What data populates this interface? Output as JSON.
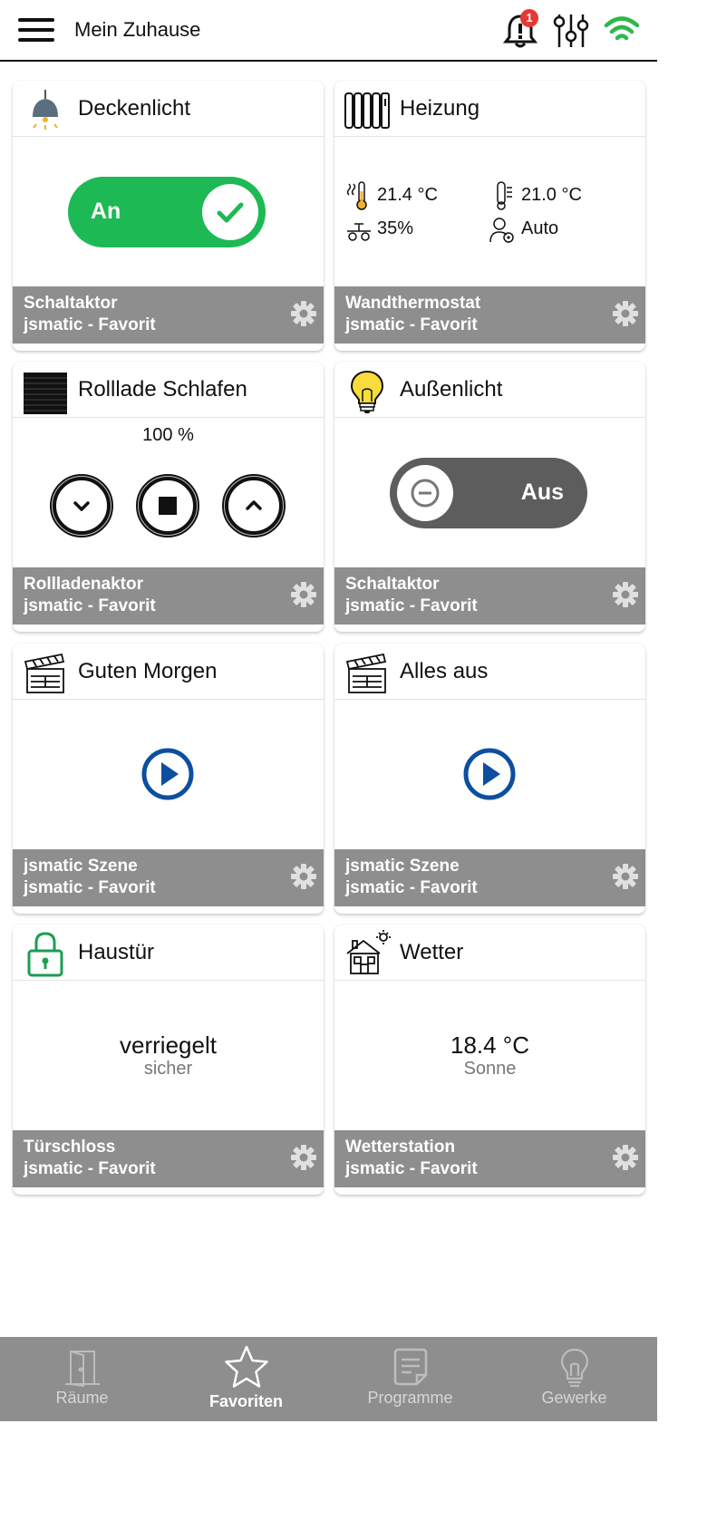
{
  "header": {
    "title": "Mein Zuhause",
    "notification_count": "1",
    "icons": [
      "menu-icon",
      "bell-icon",
      "sliders-icon",
      "wifi-icon"
    ]
  },
  "colors": {
    "on_green": "#1db954",
    "off_gray": "#5d5d5d",
    "footer_gray": "#8e8e8e",
    "play_blue": "#0d4f9e",
    "lock_green": "#1b9e52",
    "badge_red": "#e53935",
    "wifi_green": "#2eb84b"
  },
  "cards": [
    {
      "title": "Deckenlicht",
      "icon": "ceiling-lamp-icon",
      "toggle_label": "An",
      "footer_line1": "Schaltaktor",
      "footer_line2": "jsmatic - Favorit"
    },
    {
      "title": "Heizung",
      "icon": "radiator-icon",
      "actual_temp": "21.4 °C",
      "target_temp": "21.0 °C",
      "humidity": "35%",
      "mode": "Auto",
      "footer_line1": "Wandthermostat",
      "footer_line2": "jsmatic - Favorit"
    },
    {
      "title": "Rolllade Schlafen",
      "icon": "shutter-icon",
      "position": "100 %",
      "footer_line1": "Rollladenaktor",
      "footer_line2": "jsmatic - Favorit"
    },
    {
      "title": "Außenlicht",
      "icon": "light-bulb-icon",
      "toggle_label": "Aus",
      "footer_line1": "Schaltaktor",
      "footer_line2": "jsmatic - Favorit"
    },
    {
      "title": "Guten Morgen",
      "icon": "clapperboard-icon",
      "footer_line1": "jsmatic Szene",
      "footer_line2": "jsmatic - Favorit"
    },
    {
      "title": "Alles aus",
      "icon": "clapperboard-icon",
      "footer_line1": "jsmatic Szene",
      "footer_line2": "jsmatic - Favorit"
    },
    {
      "title": "Haustür",
      "icon": "padlock-icon",
      "status": "verriegelt",
      "substatus": "sicher",
      "footer_line1": "Türschloss",
      "footer_line2": "jsmatic - Favorit"
    },
    {
      "title": "Wetter",
      "icon": "house-sun-icon",
      "status": "18.4 °C",
      "substatus": "Sonne",
      "footer_line1": "Wetterstation",
      "footer_line2": "jsmatic - Favorit"
    }
  ],
  "nav": {
    "items": [
      {
        "label": "Räume",
        "icon": "door-icon"
      },
      {
        "label": "Favoriten",
        "icon": "star-icon",
        "active": true
      },
      {
        "label": "Programme",
        "icon": "document-icon"
      },
      {
        "label": "Gewerke",
        "icon": "bulb-outline-icon"
      }
    ]
  }
}
